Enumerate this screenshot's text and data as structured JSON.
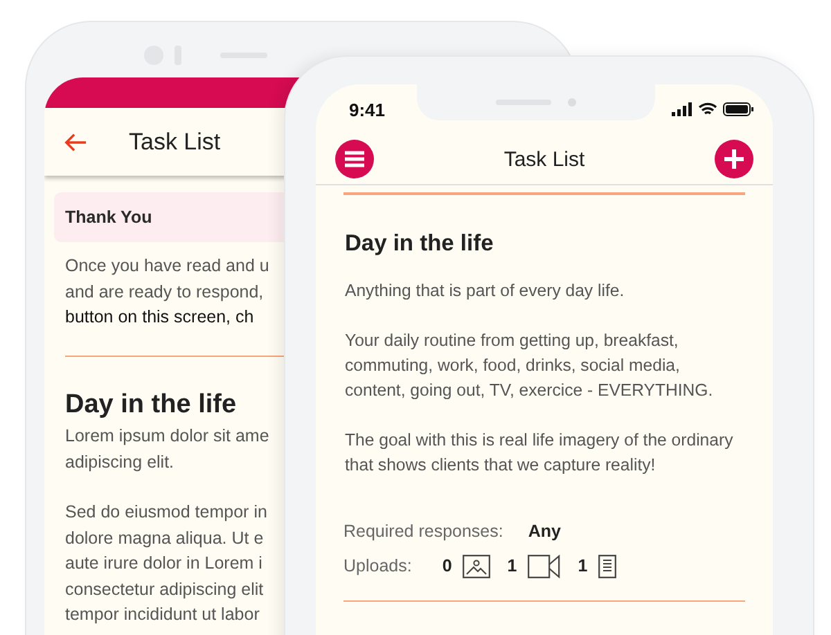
{
  "back_screen": {
    "title": "Task List",
    "notice": {
      "title": "Thank You",
      "lines": [
        {
          "text": "Once you have read and u",
          "emphasis": false
        },
        {
          "text": "and are ready to respond,",
          "emphasis": false
        },
        {
          "text": "button on this screen, ch",
          "emphasis": true
        }
      ]
    },
    "section": {
      "heading": "Day in the life",
      "paragraphs": [
        [
          "Lorem ipsum dolor sit ame",
          "adipiscing elit."
        ],
        [
          "Sed do eiusmod tempor in",
          "dolore magna aliqua. Ut e",
          "aute irure dolor in Lorem i",
          "consectetur adipiscing elit",
          "tempor incididunt ut labor"
        ]
      ]
    }
  },
  "front_screen": {
    "status_time": "9:41",
    "title": "Task List",
    "task": {
      "heading": "Day in the life",
      "paragraphs": [
        "Anything that is part of every day life.",
        "Your daily routine from getting up, breakfast, commuting, work, food, drinks, social media, content, going out, TV, exercice - EVERYTHING.",
        "The goal with this is real life imagery of the ordinary that shows clients that we capture reality!"
      ],
      "required_label": "Required responses:",
      "required_value": "Any",
      "uploads_label": "Uploads:",
      "uploads": [
        {
          "kind": "image",
          "count": "0"
        },
        {
          "kind": "video",
          "count": "1"
        },
        {
          "kind": "document",
          "count": "1"
        }
      ]
    }
  }
}
